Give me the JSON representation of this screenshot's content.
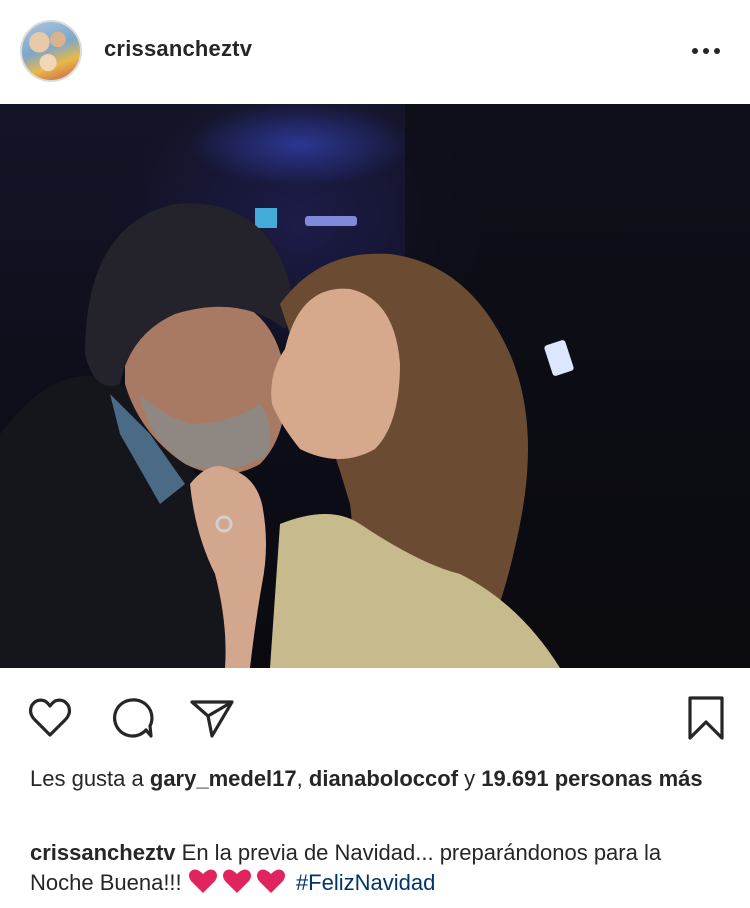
{
  "post": {
    "username": "crissancheztv",
    "avatar_icon": "profile-avatar",
    "more_icon": "ellipsis-icon"
  },
  "actions": {
    "like_icon": "heart-outline-icon",
    "comment_icon": "comment-bubble-icon",
    "share_icon": "paper-plane-icon",
    "save_icon": "bookmark-icon"
  },
  "likes": {
    "prefix": "Les gusta a",
    "user1": "gary_medel17",
    "separator": ",",
    "user2": "dianaboloccof",
    "conjunction": "y",
    "count": "19.691",
    "suffix": "personas más"
  },
  "caption": {
    "username": "crissancheztv",
    "text": "En la previa de Navidad... preparándonos para la Noche Buena!!!",
    "emoji": "❤️❤️❤️",
    "hashtag": "#FelizNavidad"
  },
  "colors": {
    "text": "#262626",
    "hashtag": "#003569",
    "heart_emoji": "#e0245e"
  }
}
